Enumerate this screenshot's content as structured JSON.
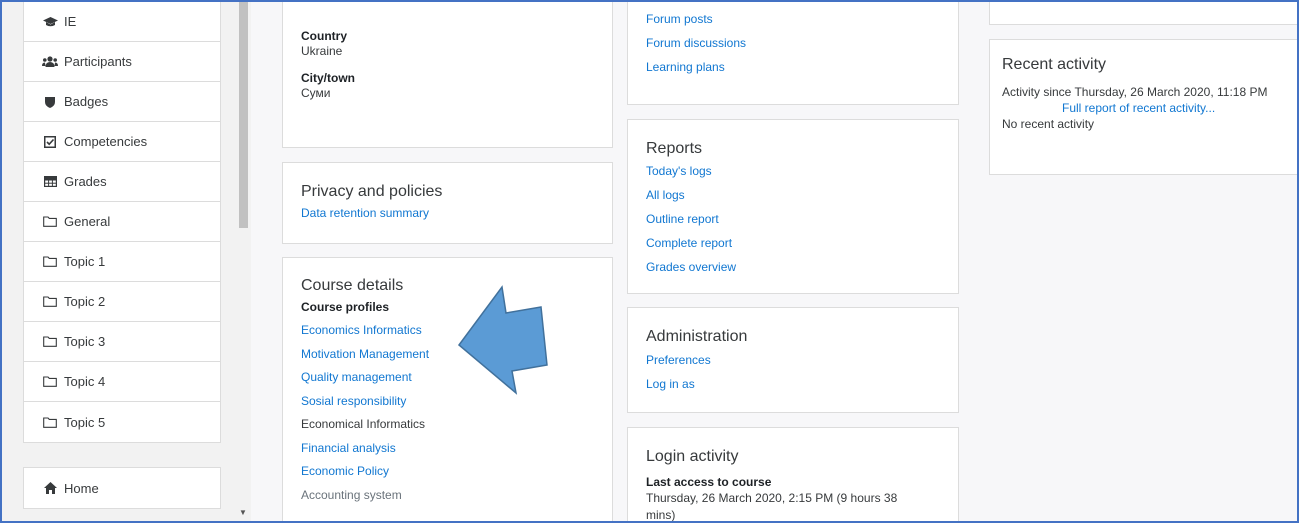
{
  "drawer": {
    "items": [
      {
        "label": "IE",
        "icon": "graduation-cap-icon"
      },
      {
        "label": "Participants",
        "icon": "users-icon"
      },
      {
        "label": "Badges",
        "icon": "shield-icon"
      },
      {
        "label": "Competencies",
        "icon": "check-square-icon"
      },
      {
        "label": "Grades",
        "icon": "table-icon"
      },
      {
        "label": "General",
        "icon": "folder-icon"
      },
      {
        "label": "Topic 1",
        "icon": "folder-icon"
      },
      {
        "label": "Topic 2",
        "icon": "folder-icon"
      },
      {
        "label": "Topic 3",
        "icon": "folder-icon"
      },
      {
        "label": "Topic 4",
        "icon": "folder-icon"
      },
      {
        "label": "Topic 5",
        "icon": "folder-icon"
      }
    ],
    "home": {
      "label": "Home",
      "icon": "home-icon"
    }
  },
  "profile": {
    "country_label": "Country",
    "country": "Ukraine",
    "city_label": "City/town",
    "city": "Суми"
  },
  "privacy": {
    "title": "Privacy and policies",
    "link": "Data retention summary"
  },
  "course_details": {
    "title": "Course details",
    "profiles_label": "Course profiles",
    "items": [
      {
        "label": "Economics Informatics",
        "style": "link"
      },
      {
        "label": "Motivation Management",
        "style": "link"
      },
      {
        "label": "Quality management",
        "style": "link"
      },
      {
        "label": "Sosial responsibility",
        "style": "link"
      },
      {
        "label": "Economical Informatics",
        "style": "text"
      },
      {
        "label": "Financial analysis",
        "style": "link"
      },
      {
        "label": "Economic Policy",
        "style": "link"
      },
      {
        "label": "Accounting system",
        "style": "grey"
      }
    ]
  },
  "forum": {
    "links": [
      "Forum posts",
      "Forum discussions",
      "Learning plans"
    ]
  },
  "reports": {
    "title": "Reports",
    "links": [
      "Today's logs",
      "All logs",
      "Outline report",
      "Complete report",
      "Grades overview"
    ]
  },
  "administration": {
    "title": "Administration",
    "links": [
      "Preferences",
      "Log in as"
    ]
  },
  "login_activity": {
    "title": "Login activity",
    "last_access_label": "Last access to course",
    "last_access_value": "Thursday, 26 March 2020, 2:15 PM  (9 hours 38 mins)"
  },
  "recent_activity": {
    "title": "Recent activity",
    "since": "Activity since Thursday, 26 March 2020, 11:18 PM",
    "full_report": "Full report of recent activity...",
    "none": "No recent activity"
  },
  "colors": {
    "link": "#1177d1",
    "arrow": "#5b9bd5",
    "arrow_stroke": "#41719c",
    "frame": "#4472c4"
  }
}
